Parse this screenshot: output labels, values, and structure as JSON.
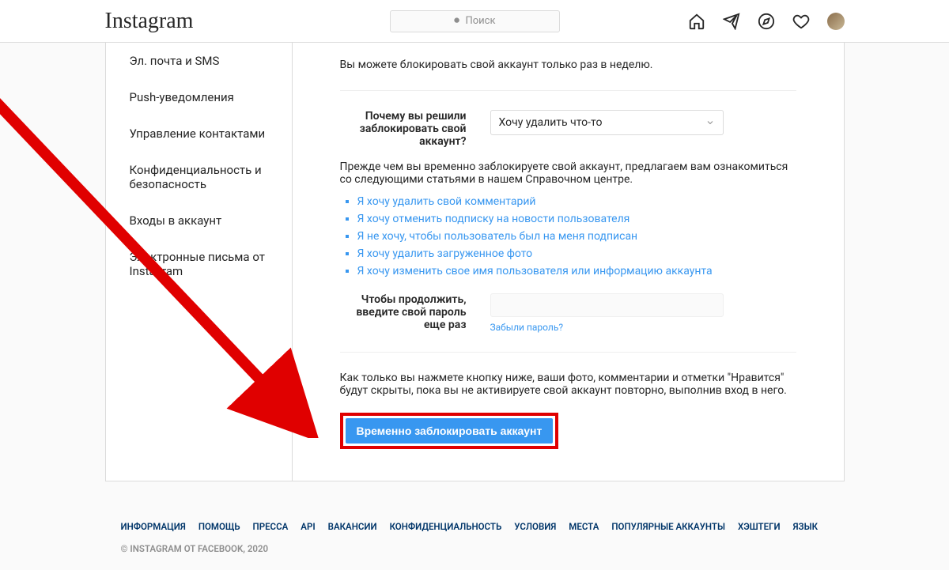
{
  "header": {
    "logo": "Instagram",
    "search_placeholder": "Поиск"
  },
  "sidebar": {
    "items": [
      "Эл. почта и SMS",
      "Push-уведомления",
      "Управление контактами",
      "Конфиденциальность и безопасность",
      "Входы в аккаунт",
      "Электронные письма от Instagram"
    ]
  },
  "main": {
    "limit_text": "Вы можете блокировать свой аккаунт только раз в неделю.",
    "reason_label": "Почему вы решили заблокировать свой аккаунт?",
    "reason_selected": "Хочу удалить что-то",
    "help_intro": "Прежде чем вы временно заблокируете свой аккаунт, предлагаем вам ознакомиться со следующими статьями в нашем Справочном центре.",
    "help_links": [
      "Я хочу удалить свой комментарий",
      "Я хочу отменить подписку на новости пользователя",
      "Я не хочу, чтобы пользователь был на меня подписан",
      "Я хочу удалить загруженное фото",
      "Я хочу изменить свое имя пользователя или информацию аккаунта"
    ],
    "password_label": "Чтобы продолжить, введите свой пароль еще раз",
    "forgot_password": "Забыли пароль?",
    "final_text": "Как только вы нажмете кнопку ниже, ваши фото, комментарии и отметки \"Нравится\" будут скрыты, пока вы не активируете свой аккаунт повторно, выполнив вход в него.",
    "disable_button": "Временно заблокировать аккаунт"
  },
  "footer": {
    "links": [
      "Информация",
      "Помощь",
      "Пресса",
      "API",
      "Вакансии",
      "Конфиденциальность",
      "Условия",
      "Места",
      "Популярные аккаунты",
      "Хэштеги",
      "Язык"
    ],
    "copyright": "© Instagram от Facebook, 2020"
  }
}
